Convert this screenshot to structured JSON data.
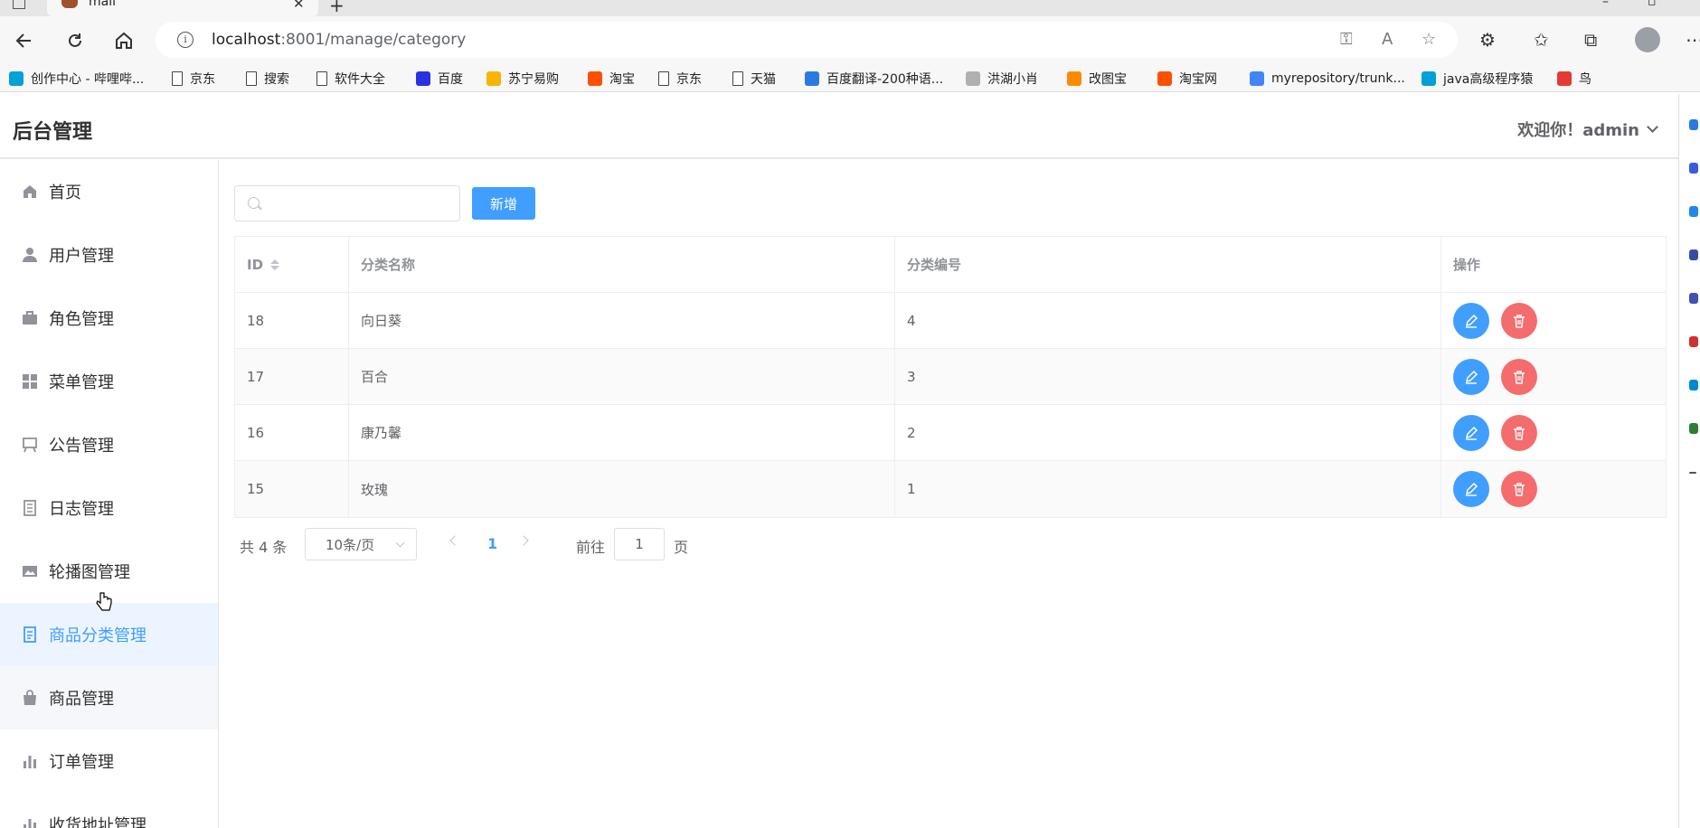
{
  "browser": {
    "tab_title": "mall",
    "url_host": "localhost",
    "url_path": ":8001/manage/category",
    "bookmarks": [
      {
        "label": "创作中心 - 哔哩哔...",
        "color": "#00a1d6"
      },
      {
        "label": "京东",
        "color": "page"
      },
      {
        "label": "搜索",
        "color": "page"
      },
      {
        "label": "软件大全",
        "color": "page"
      },
      {
        "label": "百度",
        "color": "#2932e1"
      },
      {
        "label": "苏宁易购",
        "color": "#f7b500"
      },
      {
        "label": "淘宝",
        "color": "#ff5000"
      },
      {
        "label": "京东",
        "color": "page"
      },
      {
        "label": "天猫",
        "color": "page"
      },
      {
        "label": "百度翻译-200种语...",
        "color": "#2a7ae2"
      },
      {
        "label": "洪湖小肖",
        "color": "#b0b0b0"
      },
      {
        "label": "改图宝",
        "color": "#ff8a00"
      },
      {
        "label": "淘宝网",
        "color": "#ff5000"
      },
      {
        "label": "myrepository/trunk...",
        "color": "#4285f4"
      },
      {
        "label": "java高级程序猿",
        "color": "#00a1d6"
      },
      {
        "label": "鸟",
        "color": "#e53935"
      }
    ]
  },
  "header": {
    "title": "后台管理",
    "welcome": "欢迎你！admin"
  },
  "sidebar": {
    "items": [
      {
        "label": "首页",
        "icon": "home-icon"
      },
      {
        "label": "用户管理",
        "icon": "user-icon"
      },
      {
        "label": "角色管理",
        "icon": "briefcase-icon"
      },
      {
        "label": "菜单管理",
        "icon": "grid-icon"
      },
      {
        "label": "公告管理",
        "icon": "easel-icon"
      },
      {
        "label": "日志管理",
        "icon": "notebook-icon"
      },
      {
        "label": "轮播图管理",
        "icon": "picture-icon"
      },
      {
        "label": "商品分类管理",
        "icon": "document-icon",
        "active": true
      },
      {
        "label": "商品管理",
        "icon": "shopping-bag-icon"
      },
      {
        "label": "订单管理",
        "icon": "bar-chart-icon"
      },
      {
        "label": "收货地址管理",
        "icon": "bar-chart-icon"
      }
    ]
  },
  "toolbar": {
    "search_placeholder": "",
    "add_label": "新增"
  },
  "table": {
    "columns": [
      "ID",
      "分类名称",
      "分类编号",
      "操作"
    ],
    "rows": [
      {
        "id": "18",
        "name": "向日葵",
        "code": "4"
      },
      {
        "id": "17",
        "name": "百合",
        "code": "3"
      },
      {
        "id": "16",
        "name": "康乃馨",
        "code": "2"
      },
      {
        "id": "15",
        "name": "玫瑰",
        "code": "1"
      }
    ]
  },
  "pagination": {
    "total": "共 4 条",
    "page_size": "10条/页",
    "current_page": "1",
    "goto_label": "前往",
    "goto_value": "1",
    "page_suffix": "页"
  },
  "colors": {
    "primary": "#409eff",
    "danger": "#f56c6c",
    "active_bg": "#ecf5ff"
  }
}
